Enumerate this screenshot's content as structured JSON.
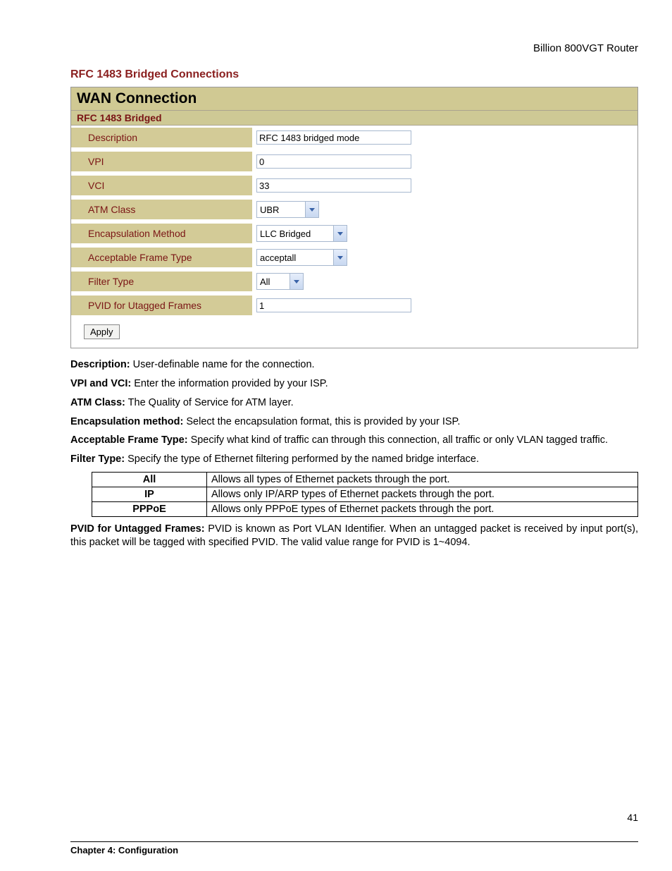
{
  "header": {
    "router_name": "Billion 800VGT Router"
  },
  "section": {
    "title": "RFC 1483 Bridged Connections"
  },
  "panel": {
    "main_title": "WAN Connection",
    "sub_title": "RFC 1483 Bridged",
    "rows": {
      "description": {
        "label": "Description",
        "value": "RFC 1483 bridged mode"
      },
      "vpi": {
        "label": "VPI",
        "value": "0"
      },
      "vci": {
        "label": "VCI",
        "value": "33"
      },
      "atm_class": {
        "label": "ATM Class",
        "value": "UBR"
      },
      "encap": {
        "label": "Encapsulation Method",
        "value": "LLC Bridged"
      },
      "frame_type": {
        "label": "Acceptable Frame Type",
        "value": "acceptall"
      },
      "filter_type": {
        "label": "Filter Type",
        "value": "All"
      },
      "pvid": {
        "label": "PVID for Utagged Frames",
        "value": "1"
      }
    },
    "apply_label": "Apply"
  },
  "descriptions": {
    "description": {
      "key": "Description:",
      "text": " User-definable name for the connection."
    },
    "vpi_vci": {
      "key": "VPI and VCI:",
      "text": " Enter the information provided by your ISP."
    },
    "atm_class": {
      "key": "ATM Class:",
      "text": " The Quality of Service for ATM layer."
    },
    "encap": {
      "key": "Encapsulation method:",
      "text": " Select the encapsulation format, this is provided by your ISP."
    },
    "frame_type": {
      "key": "Acceptable Frame Type:",
      "text": " Specify what kind of traffic can through this connection, all traffic or only VLAN tagged traffic."
    },
    "filter_type": {
      "key": "Filter Type:",
      "text": " Specify the type of Ethernet filtering performed by the named bridge interface."
    },
    "pvid": {
      "key": "PVID for Untagged Frames:",
      "text": " PVID is known as Port VLAN Identifier. When an untagged packet is received by input port(s), this packet will be tagged with specified PVID. The valid value range for PVID is 1~4094."
    }
  },
  "filter_table": {
    "rows": [
      {
        "key": "All",
        "desc": "Allows all types of Ethernet packets through the port."
      },
      {
        "key": "IP",
        "desc": "Allows only IP/ARP types of Ethernet packets through the port."
      },
      {
        "key": "PPPoE",
        "desc": "Allows only PPPoE types of Ethernet packets through the port."
      }
    ]
  },
  "footer": {
    "chapter": "Chapter 4: Configuration",
    "page_number": "41"
  }
}
